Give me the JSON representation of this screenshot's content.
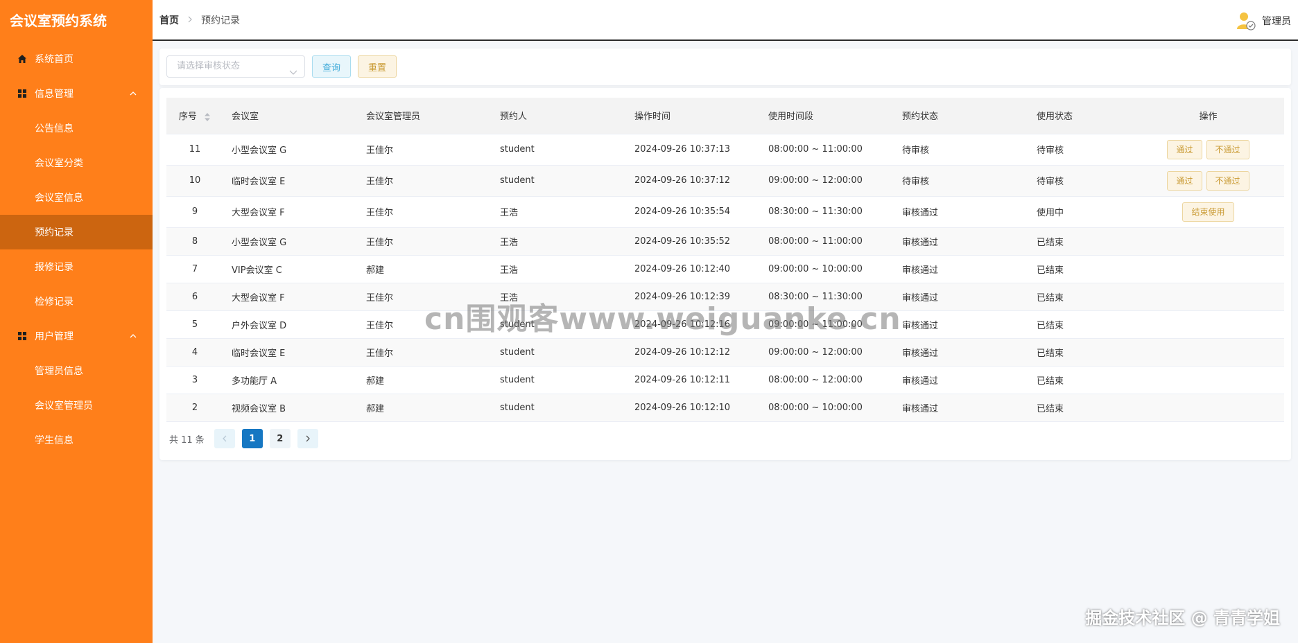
{
  "sidebar": {
    "brand": "会议室预约系统",
    "home": "系统首页",
    "groups": [
      {
        "label": "信息管理",
        "items": [
          "公告信息",
          "会议室分类",
          "会议室信息",
          "预约记录",
          "报修记录",
          "检修记录"
        ]
      },
      {
        "label": "用户管理",
        "items": [
          "管理员信息",
          "会议室管理员",
          "学生信息"
        ]
      }
    ],
    "active_item": "预约记录"
  },
  "header": {
    "home": "首页",
    "current": "预约记录",
    "user_name": "管理员"
  },
  "search": {
    "placeholder": "请选择审核状态",
    "query_label": "查询",
    "reset_label": "重置"
  },
  "table": {
    "columns": [
      "序号",
      "会议室",
      "会议室管理员",
      "预约人",
      "操作时间",
      "使用时间段",
      "预约状态",
      "使用状态",
      "操作"
    ],
    "rows": [
      {
        "idx": "11",
        "room": "小型会议室 G",
        "manager": "王佳尔",
        "booker": "student",
        "op_time": "2024-09-26 10:37:13",
        "period": "08:00:00 ~ 11:00:00",
        "status": "待审核",
        "use_status": "待审核",
        "actions": [
          "通过",
          "不通过"
        ]
      },
      {
        "idx": "10",
        "room": "临时会议室 E",
        "manager": "王佳尔",
        "booker": "student",
        "op_time": "2024-09-26 10:37:12",
        "period": "09:00:00 ~ 12:00:00",
        "status": "待审核",
        "use_status": "待审核",
        "actions": [
          "通过",
          "不通过"
        ]
      },
      {
        "idx": "9",
        "room": "大型会议室 F",
        "manager": "王佳尔",
        "booker": "王浩",
        "op_time": "2024-09-26 10:35:54",
        "period": "08:30:00 ~ 11:30:00",
        "status": "审核通过",
        "use_status": "使用中",
        "actions": [
          "结束使用"
        ]
      },
      {
        "idx": "8",
        "room": "小型会议室 G",
        "manager": "王佳尔",
        "booker": "王浩",
        "op_time": "2024-09-26 10:35:52",
        "period": "08:00:00 ~ 11:00:00",
        "status": "审核通过",
        "use_status": "已结束",
        "actions": []
      },
      {
        "idx": "7",
        "room": "VIP会议室 C",
        "manager": "郝建",
        "booker": "王浩",
        "op_time": "2024-09-26 10:12:40",
        "period": "09:00:00 ~ 10:00:00",
        "status": "审核通过",
        "use_status": "已结束",
        "actions": []
      },
      {
        "idx": "6",
        "room": "大型会议室 F",
        "manager": "王佳尔",
        "booker": "王浩",
        "op_time": "2024-09-26 10:12:39",
        "period": "08:30:00 ~ 11:30:00",
        "status": "审核通过",
        "use_status": "已结束",
        "actions": []
      },
      {
        "idx": "5",
        "room": "户外会议室 D",
        "manager": "王佳尔",
        "booker": "student",
        "op_time": "2024-09-26 10:12:16",
        "period": "09:00:00 ~ 11:00:00",
        "status": "审核通过",
        "use_status": "已结束",
        "actions": []
      },
      {
        "idx": "4",
        "room": "临时会议室 E",
        "manager": "王佳尔",
        "booker": "student",
        "op_time": "2024-09-26 10:12:12",
        "period": "09:00:00 ~ 12:00:00",
        "status": "审核通过",
        "use_status": "已结束",
        "actions": []
      },
      {
        "idx": "3",
        "room": "多功能厅 A",
        "manager": "郝建",
        "booker": "student",
        "op_time": "2024-09-26 10:12:11",
        "period": "08:00:00 ~ 12:00:00",
        "status": "审核通过",
        "use_status": "已结束",
        "actions": []
      },
      {
        "idx": "2",
        "room": "视频会议室 B",
        "manager": "郝建",
        "booker": "student",
        "op_time": "2024-09-26 10:12:10",
        "period": "08:00:00 ~ 10:00:00",
        "status": "审核通过",
        "use_status": "已结束",
        "actions": []
      }
    ]
  },
  "pagination": {
    "total": "共 11 条",
    "pages": [
      "1",
      "2"
    ],
    "current": "1"
  },
  "watermark": "cn围观客www.weiguanke.cn",
  "corner_mark": "掘金技术社区 @ 青青学姐",
  "colors": {
    "sidebar": "#ff7f1a",
    "sidebar_active": "#cc6510",
    "accent_blue": "#1677c2",
    "action_text": "#c99a33"
  }
}
